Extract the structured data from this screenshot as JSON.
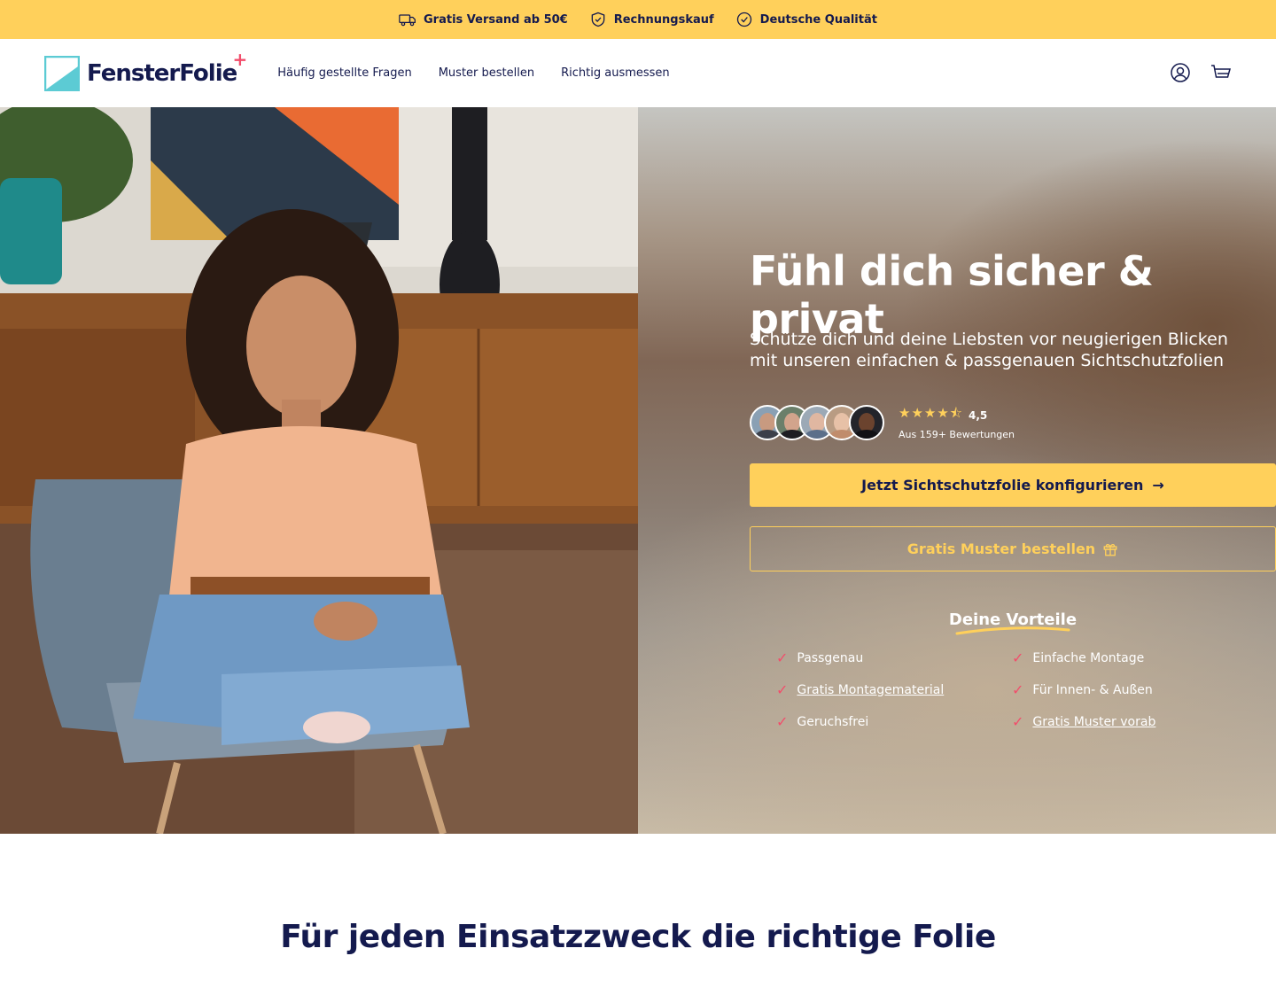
{
  "topbar": {
    "items": [
      {
        "icon": "truck-icon",
        "label": "Gratis Versand ab 50€"
      },
      {
        "icon": "shield-check-icon",
        "label": "Rechnungskauf"
      },
      {
        "icon": "badge-check-icon",
        "label": "Deutsche Qualität"
      }
    ]
  },
  "header": {
    "logo_text": "FensterFolie",
    "logo_plus": "+",
    "nav": [
      {
        "label": "Häufig gestellte Fragen"
      },
      {
        "label": "Muster bestellen"
      },
      {
        "label": "Richtig ausmessen"
      }
    ],
    "icons": [
      "account-icon",
      "cart-icon"
    ]
  },
  "hero": {
    "title": "Fühl dich sicher & privat",
    "subtitle": "Schütze dich und deine Liebsten vor neugierigen Blicken mit unseren einfachen & passgenauen Sichtschutzfolien",
    "rating": {
      "stars": "★★★★⯪",
      "stars_value": 4.5,
      "value": "4,5",
      "count": "Aus 159+ Bewertungen"
    },
    "cta_primary": "Jetzt Sichtschutzfolie konfigurieren",
    "cta_primary_icon": "→",
    "cta_secondary": "Gratis Muster bestellen",
    "cta_secondary_icon": "gift-icon",
    "benefits_title": "Deine Vorteile",
    "benefits": [
      {
        "label": "Passgenau",
        "link": false
      },
      {
        "label": "Einfache Montage",
        "link": false
      },
      {
        "label": "Gratis Montagematerial",
        "link": true
      },
      {
        "label": "Für Innen- & Außen",
        "link": false
      },
      {
        "label": "Geruchsfrei",
        "link": false
      },
      {
        "label": "Gratis Muster vorab",
        "link": true
      }
    ],
    "check_symbol": "✓"
  },
  "section": {
    "title": "Für jeden Einsatzzweck die richtige Folie"
  },
  "colors": {
    "accent": "#ffd05b",
    "navy": "#141a4e",
    "pink": "#f24d6b",
    "teal": "#5ccbd4"
  }
}
